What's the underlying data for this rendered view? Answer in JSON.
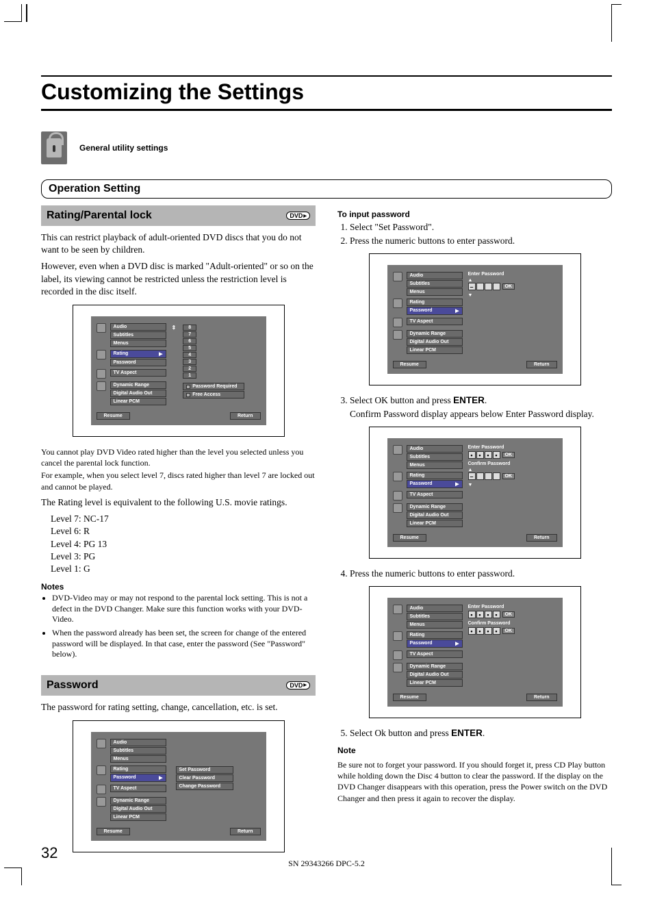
{
  "title": "Customizing the Settings",
  "util_label": "General utility settings",
  "op_setting": "Operation Setting",
  "rating_head": "Rating/Parental lock",
  "dvd": "DVD",
  "rating_p1": "This can restrict playback of adult-oriented DVD discs that you do not want to be seen by children.",
  "rating_p2": "However, even when a DVD disc is marked \"Adult-oriented\" or so on the label, its viewing cannot be restricted unless the restriction level is recorded in the disc itself.",
  "rating_p3a": "You cannot play DVD Video rated higher than the level you selected unless you cancel the parental lock function.",
  "rating_p3b": "For example, when you select level 7, discs rated higher than level 7 are locked out and cannot be played.",
  "rating_eq": "The Rating level is equivalent to the following U.S. movie ratings.",
  "levels": {
    "l7": "Level 7:  NC-17",
    "l6": "Level 6:  R",
    "l4": "Level 4:  PG 13",
    "l3": "Level 3:  PG",
    "l1": "Level 1:  G"
  },
  "notes_hd": "Notes",
  "note1": "DVD-Video may or may not respond to the parental lock setting. This is not a defect in the DVD Changer. Make sure this function works with your DVD-Video.",
  "note2": "When the password already has been set, the screen for change of the entered password will be displayed. In that case, enter the password (See \"Password\" below).",
  "password_head": "Password",
  "password_p": "The password for rating setting, change, cancellation, etc. is set.",
  "input_hd": "To input password",
  "step1": "Select \"Set Password\".",
  "step2": "Press the numeric buttons to enter password.",
  "step3a": "Select OK button and press ",
  "step3_enter": "ENTER",
  "step3b": ".",
  "step3c": "Confirm Password display appears below Enter Password display.",
  "step4": "Press the numeric buttons to enter password.",
  "step5a": "Select Ok button and press ",
  "step5_enter": "ENTER",
  "step5b": ".",
  "note_hd2": "Note",
  "note_bottom": "Be sure not to forget your password. If you should forget it, press CD Play button while holding down the Disc 4 button to clear the password. If the display on the DVD Changer disappears with this operation, press the Power switch on the DVD Changer and then press it again to recover the display.",
  "page_num": "32",
  "footer": "SN 29343266 DPC-5.2",
  "osd": {
    "audio": "Audio",
    "subtitles": "Subtitles",
    "menus": "Menus",
    "rating": "Rating",
    "password": "Password",
    "tvaspect": "TV Aspect",
    "dyn": "Dynamic Range",
    "dao": "Digital Audio Out",
    "lpcm": "Linear PCM",
    "resume": "Resume",
    "return": "Return",
    "pw_req": "Password Required",
    "free": "Free Access",
    "setpw": "Set Password",
    "clearpw": "Clear Password",
    "changepw": "Change Password",
    "enterpw": "Enter Password",
    "confirmpw": "Confirm Password",
    "ok": "OK"
  }
}
